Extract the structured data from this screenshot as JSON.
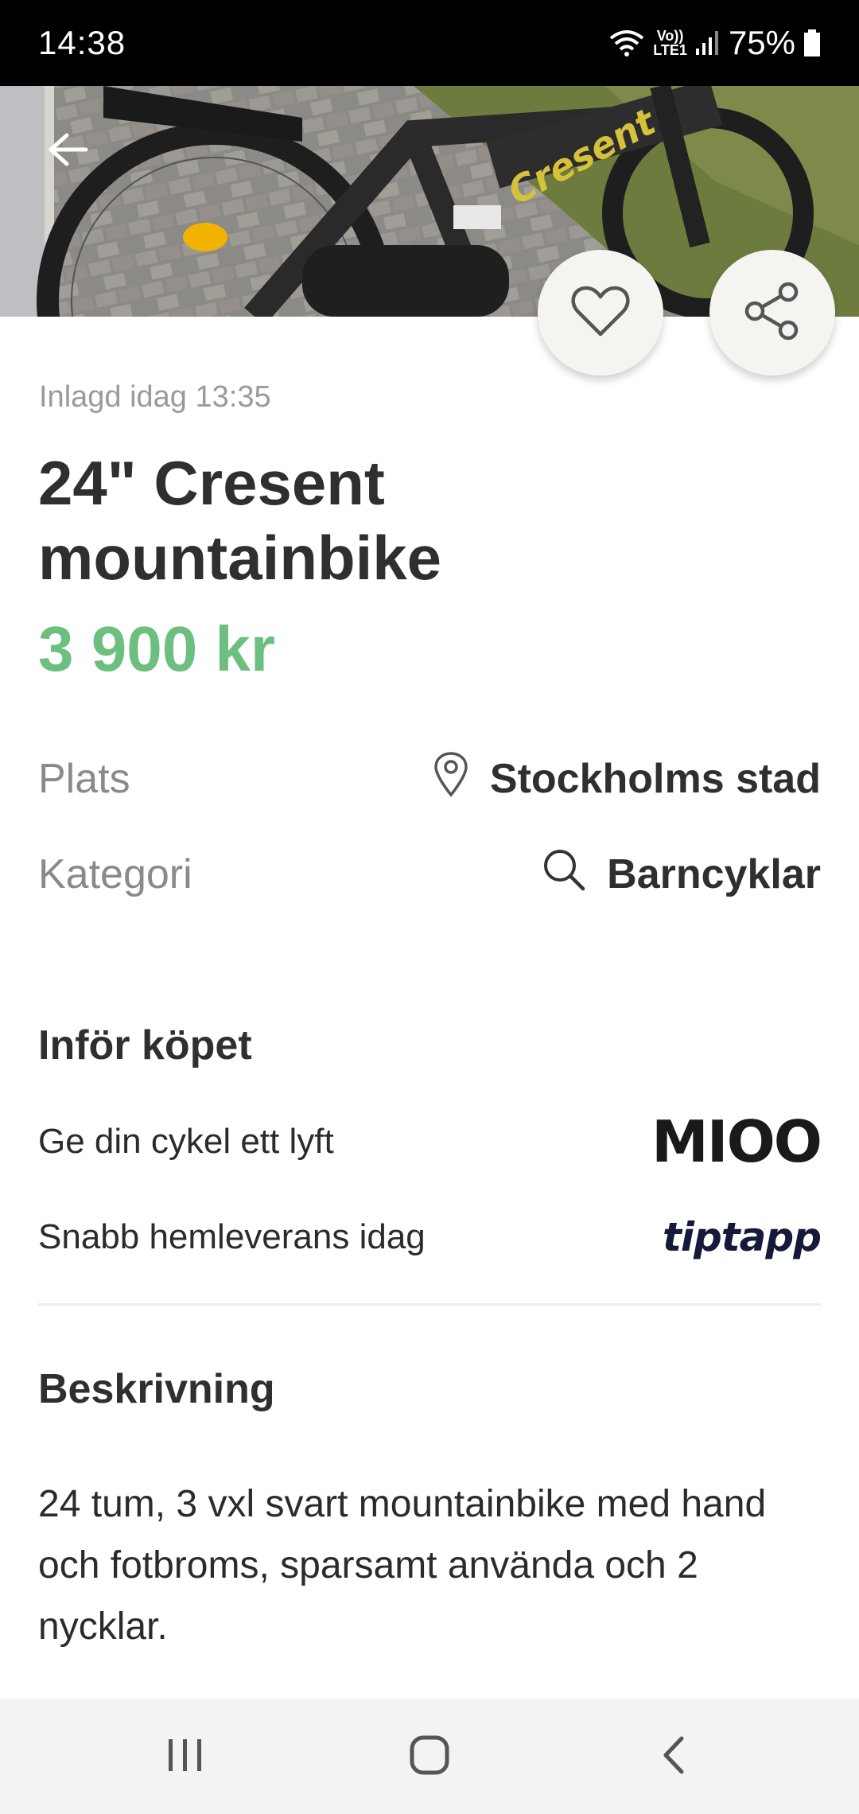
{
  "status_bar": {
    "time": "14:38",
    "network_top": "Vo))",
    "network_bottom": "LTE1",
    "battery": "75%"
  },
  "listing": {
    "posted": "Inlagd idag 13:35",
    "title": "24\" Cresent mountainbike",
    "price": "3 900 kr",
    "location_label": "Plats",
    "location_value": "Stockholms stad",
    "category_label": "Kategori",
    "category_value": "Barncyklar"
  },
  "before_purchase": {
    "title": "Inför köpet",
    "items": [
      {
        "label": "Ge din cykel ett lyft",
        "logo": "MIOO"
      },
      {
        "label": "Snabb hemleverans idag",
        "logo": "tiptapp"
      }
    ]
  },
  "description": {
    "title": "Beskrivning",
    "text": "24 tum, 3 vxl svart mountainbike med hand och fotbroms, sparsamt använda och 2 nycklar."
  },
  "hero": {
    "frame_text": "Cresent"
  },
  "colors": {
    "price": "#6cbf7e",
    "text": "#2f2f2f",
    "muted": "#9a9a9a",
    "nav_bg": "#f3f3f3"
  },
  "icons": {
    "back": "arrow-left-icon",
    "favorite": "heart-icon",
    "share": "share-icon",
    "location": "location-pin-icon",
    "category": "search-icon",
    "nav_recents": "recent-apps-icon",
    "nav_home": "home-icon",
    "nav_back": "back-chevron-icon"
  }
}
